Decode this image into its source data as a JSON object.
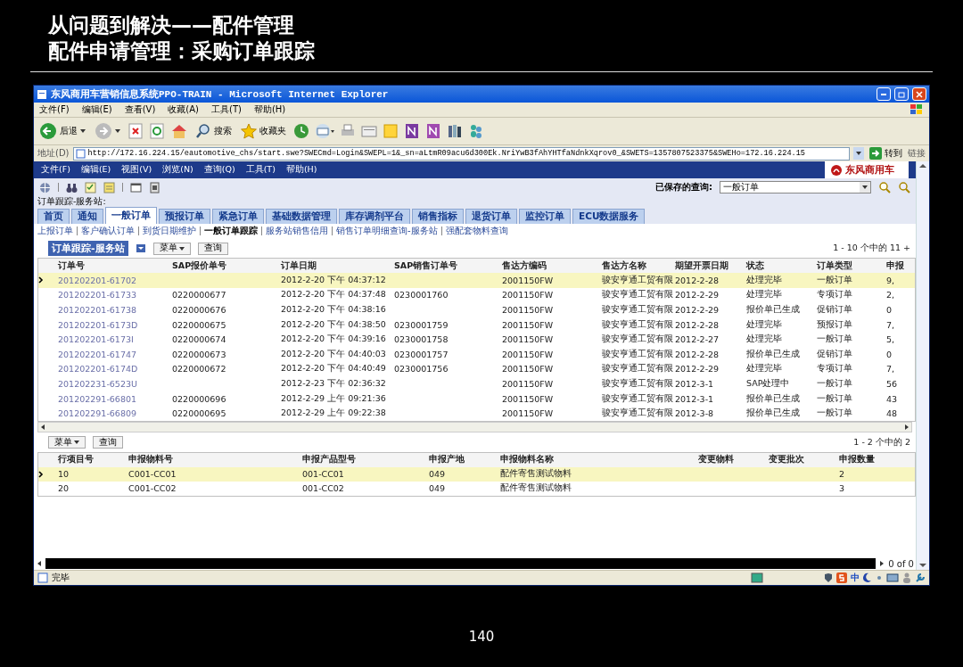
{
  "slide": {
    "title_lines": [
      "从问题到解决——配件管理",
      "配件申请管理：采购订单跟踪"
    ],
    "page_number": "140"
  },
  "browser": {
    "title": "东风商用车营销信息系统PPO-TRAIN - Microsoft Internet Explorer",
    "menu": [
      "文件(F)",
      "编辑(E)",
      "查看(V)",
      "收藏(A)",
      "工具(T)",
      "帮助(H)"
    ],
    "toolbar": {
      "back": "后退",
      "search": "搜索",
      "favorites": "收藏夹"
    },
    "address": {
      "label": "地址(D)",
      "url": "http://172.16.224.15/eautomotive_chs/start.swe?SWECmd=Login&SWEPL=1&_sn=aLtmR09acu6d300Ek.NriYwB3fAhYHTfaNdnkXqrov0_&SWETS=1357807523375&SWEHo=172.16.224.15",
      "go": "转到",
      "links": "链接"
    },
    "status": "完毕",
    "ime": "中"
  },
  "app": {
    "menu": [
      "文件(F)",
      "编辑(E)",
      "视图(V)",
      "浏览(N)",
      "查询(Q)",
      "工具(T)",
      "帮助(H)"
    ],
    "logo": "东风商用车",
    "saved_query_label": "已保存的查询:",
    "saved_query": "一般订单",
    "breadcrumb": "订单跟踪-服务站:",
    "tabs": [
      {
        "label": "首页",
        "selected": false
      },
      {
        "label": "通知",
        "selected": false
      },
      {
        "label": "一般订单",
        "selected": true
      },
      {
        "label": "预报订单",
        "selected": false
      },
      {
        "label": "紧急订单",
        "selected": false
      },
      {
        "label": "基础数据管理",
        "selected": false
      },
      {
        "label": "库存调剂平台",
        "selected": false
      },
      {
        "label": "销售指标",
        "selected": false
      },
      {
        "label": "退货订单",
        "selected": false
      },
      {
        "label": "监控订单",
        "selected": false
      },
      {
        "label": "ECU数据服务",
        "selected": false
      }
    ],
    "subnav": [
      {
        "label": "上报订单",
        "selected": false
      },
      {
        "label": "客户确认订单",
        "selected": false
      },
      {
        "label": "到货日期维护",
        "selected": false
      },
      {
        "label": "一般订单跟踪",
        "selected": true
      },
      {
        "label": "服务站销售信用",
        "selected": false
      },
      {
        "label": "销售订单明细查询-服务站",
        "selected": false
      },
      {
        "label": "强配套物料查询",
        "selected": false
      }
    ],
    "list": {
      "title": "订单跟踪-服务站",
      "menu_button": "菜单",
      "query_button": "查询",
      "count": "1 - 10 个中的 11 +",
      "columns": [
        "订单号",
        "SAP报价单号",
        "订单日期",
        "SAP销售订单号",
        "售达方编码",
        "售达方名称",
        "期望开票日期",
        "状态",
        "订单类型",
        "申报"
      ],
      "rows": [
        {
          "selected": true,
          "cells": [
            "201202201-61702",
            "",
            "2012-2-20 下午 04:37:12",
            "",
            "2001150FW",
            "骏安亨通工贸有限",
            "2012-2-28",
            "处理完毕",
            "一般订单",
            "9,"
          ]
        },
        {
          "selected": false,
          "cells": [
            "201202201-61733",
            "0220000677",
            "2012-2-20 下午 04:37:48",
            "0230001760",
            "2001150FW",
            "骏安亨通工贸有限",
            "2012-2-29",
            "处理完毕",
            "专项订单",
            "2,"
          ]
        },
        {
          "selected": false,
          "cells": [
            "201202201-61738",
            "0220000676",
            "2012-2-20 下午 04:38:16",
            "",
            "2001150FW",
            "骏安亨通工贸有限",
            "2012-2-29",
            "报价单已生成",
            "促销订单",
            "0"
          ]
        },
        {
          "selected": false,
          "cells": [
            "201202201-6173D",
            "0220000675",
            "2012-2-20 下午 04:38:50",
            "0230001759",
            "2001150FW",
            "骏安亨通工贸有限",
            "2012-2-28",
            "处理完毕",
            "预报订单",
            "7,"
          ]
        },
        {
          "selected": false,
          "cells": [
            "201202201-6173I",
            "0220000674",
            "2012-2-20 下午 04:39:16",
            "0230001758",
            "2001150FW",
            "骏安亨通工贸有限",
            "2012-2-27",
            "处理完毕",
            "一般订单",
            "5,"
          ]
        },
        {
          "selected": false,
          "cells": [
            "201202201-61747",
            "0220000673",
            "2012-2-20 下午 04:40:03",
            "0230001757",
            "2001150FW",
            "骏安亨通工贸有限",
            "2012-2-28",
            "报价单已生成",
            "促销订单",
            "0"
          ]
        },
        {
          "selected": false,
          "cells": [
            "201202201-6174D",
            "0220000672",
            "2012-2-20 下午 04:40:49",
            "0230001756",
            "2001150FW",
            "骏安亨通工贸有限",
            "2012-2-29",
            "处理完毕",
            "专项订单",
            "7,"
          ]
        },
        {
          "selected": false,
          "cells": [
            "201202231-6523U",
            "",
            "2012-2-23 下午 02:36:32",
            "",
            "2001150FW",
            "骏安亨通工贸有限",
            "2012-3-1",
            "SAP处理中",
            "一般订单",
            "56"
          ]
        },
        {
          "selected": false,
          "cells": [
            "201202291-66801",
            "0220000696",
            "2012-2-29 上午 09:21:36",
            "",
            "2001150FW",
            "骏安亨通工贸有限",
            "2012-3-1",
            "报价单已生成",
            "一般订单",
            "43"
          ]
        },
        {
          "selected": false,
          "cells": [
            "201202291-66809",
            "0220000695",
            "2012-2-29 上午 09:22:38",
            "",
            "2001150FW",
            "骏安亨通工贸有限",
            "2012-3-8",
            "报价单已生成",
            "一般订单",
            "48"
          ]
        }
      ]
    },
    "detail": {
      "menu_button": "菜单",
      "query_button": "查询",
      "count": "1 - 2 个中的 2",
      "columns": [
        "行项目号",
        "申报物料号",
        "申报产品型号",
        "申报产地",
        "申报物料名称",
        "变更物料",
        "变更批次",
        "申报数量"
      ],
      "rows": [
        {
          "selected": true,
          "cells": [
            "10",
            "C001-CC01",
            "001-CC01",
            "049",
            "配件寄售测试物料",
            "",
            "",
            "2"
          ]
        },
        {
          "selected": false,
          "cells": [
            "20",
            "C001-CC02",
            "001-CC02",
            "049",
            "配件寄售测试物料",
            "",
            "",
            "3"
          ]
        }
      ]
    },
    "footer_count": "0 of 0"
  }
}
